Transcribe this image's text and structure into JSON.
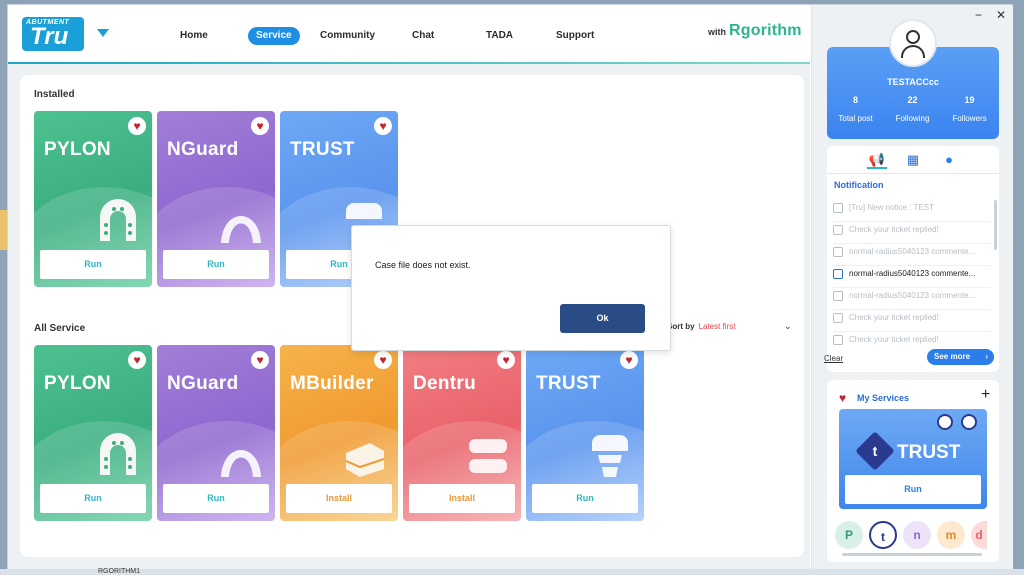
{
  "app": {
    "logo_small": "ABUTMENT",
    "logo_big": "Tru",
    "with_label": "with",
    "brand": "Rgorithm"
  },
  "nav": [
    {
      "label": "Home"
    },
    {
      "label": "Service"
    },
    {
      "label": "Community"
    },
    {
      "label": "Chat"
    },
    {
      "label": "TADA"
    },
    {
      "label": "Support"
    }
  ],
  "sections": {
    "installed": "Installed",
    "all": "All Service"
  },
  "installed_cards": [
    {
      "name": "PYLON",
      "button": "Run"
    },
    {
      "name": "NGuard",
      "button": "Run"
    },
    {
      "name": "TRUST",
      "button": "Run"
    }
  ],
  "all_cards": [
    {
      "name": "PYLON",
      "button": "Run"
    },
    {
      "name": "NGuard",
      "button": "Run"
    },
    {
      "name": "MBuilder",
      "button": "Install"
    },
    {
      "name": "Dentru",
      "button": "Install"
    },
    {
      "name": "TRUST",
      "button": "Run"
    }
  ],
  "sort": {
    "label": "Sort by",
    "value": "Latest first"
  },
  "dialog": {
    "message": "Case file does not exist.",
    "ok": "Ok"
  },
  "window": {
    "minimize": "−",
    "close": "✕"
  },
  "profile": {
    "username": "TESTACCcc",
    "stats": [
      {
        "value": "8",
        "label": "Total post"
      },
      {
        "value": "22",
        "label": "Following"
      },
      {
        "value": "19",
        "label": "Followers"
      }
    ]
  },
  "notifications": {
    "title": "Notification",
    "items": [
      {
        "text": "[Tru] New notice : TEST"
      },
      {
        "text": "Check your ticket replied!"
      },
      {
        "text": "normal-radius5040123 commente..."
      },
      {
        "text": "normal-radius5040123 commente..."
      },
      {
        "text": "normal-radius5040123 commente..."
      },
      {
        "text": "Check your ticket replied!"
      },
      {
        "text": "Check your ticket replied!"
      }
    ],
    "clear": "Clear",
    "see_more": "See more"
  },
  "my_services": {
    "title": "My Services",
    "plus": "+",
    "card_name": "TRUST",
    "card_button": "Run"
  },
  "taskbar": {
    "label": "RGORITHM1"
  },
  "colors": {
    "accent": "#1e8fe3",
    "ok_button": "#2a4c85",
    "heart": "#c3242f",
    "sort_value": "#e0464d"
  }
}
